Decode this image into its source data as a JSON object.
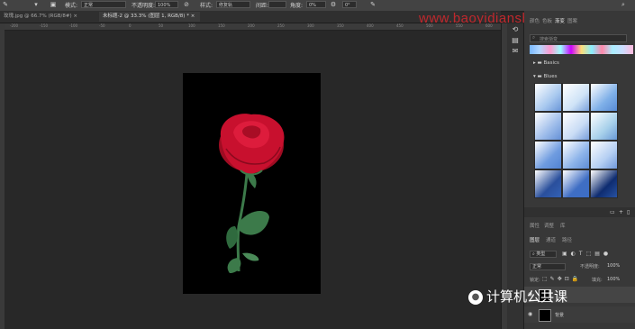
{
  "options_bar": {
    "mode_label": "模式:",
    "mode_value": "正常",
    "opacity_label": "不透明度:",
    "opacity_value": "100%",
    "style_label": "样式:",
    "style_value": "修复轨",
    "spacing_label": "间距:",
    "angle_label": "角度:",
    "angle_value": "0%",
    "extra_value": "0°"
  },
  "tabs": [
    {
      "label": "玫瑰.jpg @ 66.7% (RGB/8#)"
    },
    {
      "label": "未标题-2 @ 33.3% (图层 1, RGB/8) *",
      "active": true
    }
  ],
  "ruler_ticks": [
    "-200",
    "-150",
    "-100",
    "-50",
    "0",
    "50",
    "100",
    "150",
    "200",
    "250",
    "300",
    "350",
    "400",
    "450",
    "500",
    "550",
    "600"
  ],
  "watermark": "www.baoyidianshi.com",
  "panel": {
    "tabs": [
      {
        "label": "颜色"
      },
      {
        "label": "色板"
      },
      {
        "label": "渐变",
        "active": true
      },
      {
        "label": "图案"
      }
    ],
    "search_placeholder": "搜索渐变",
    "folders": [
      {
        "label": "Basics"
      },
      {
        "label": "Blues"
      }
    ],
    "layers_tabs": [
      {
        "label": "属性"
      },
      {
        "label": "调整"
      },
      {
        "label": "库"
      }
    ],
    "layers_subtabs": [
      {
        "label": "图层",
        "active": true
      },
      {
        "label": "通道"
      },
      {
        "label": "路径"
      }
    ],
    "kind_label": "类型",
    "blend_mode": "正常",
    "opacity_label": "不透明度:",
    "opacity_value": "100%",
    "lock_label": "锁定:",
    "fill_label": "填充:",
    "fill_value": "100%",
    "layer_name": "背景"
  },
  "colors": {
    "watermark": "#c0282d",
    "artboard": "#000000",
    "rose": "#c8102e",
    "leaf": "#3c7a4a"
  },
  "gradient_swatches": [
    [
      "#a9c9ef",
      "#cfe3f7",
      "#7fb0e8"
    ],
    [
      "#9dbcea",
      "#c9dcf5",
      "#a7d0ea"
    ],
    [
      "#6f9ce0",
      "#8db4ea",
      "#b5cff3"
    ],
    [
      "#2a4f9c",
      "#3f6ec4",
      "#0e2c70"
    ]
  ],
  "footer": {
    "brand": "计算机公共课"
  }
}
